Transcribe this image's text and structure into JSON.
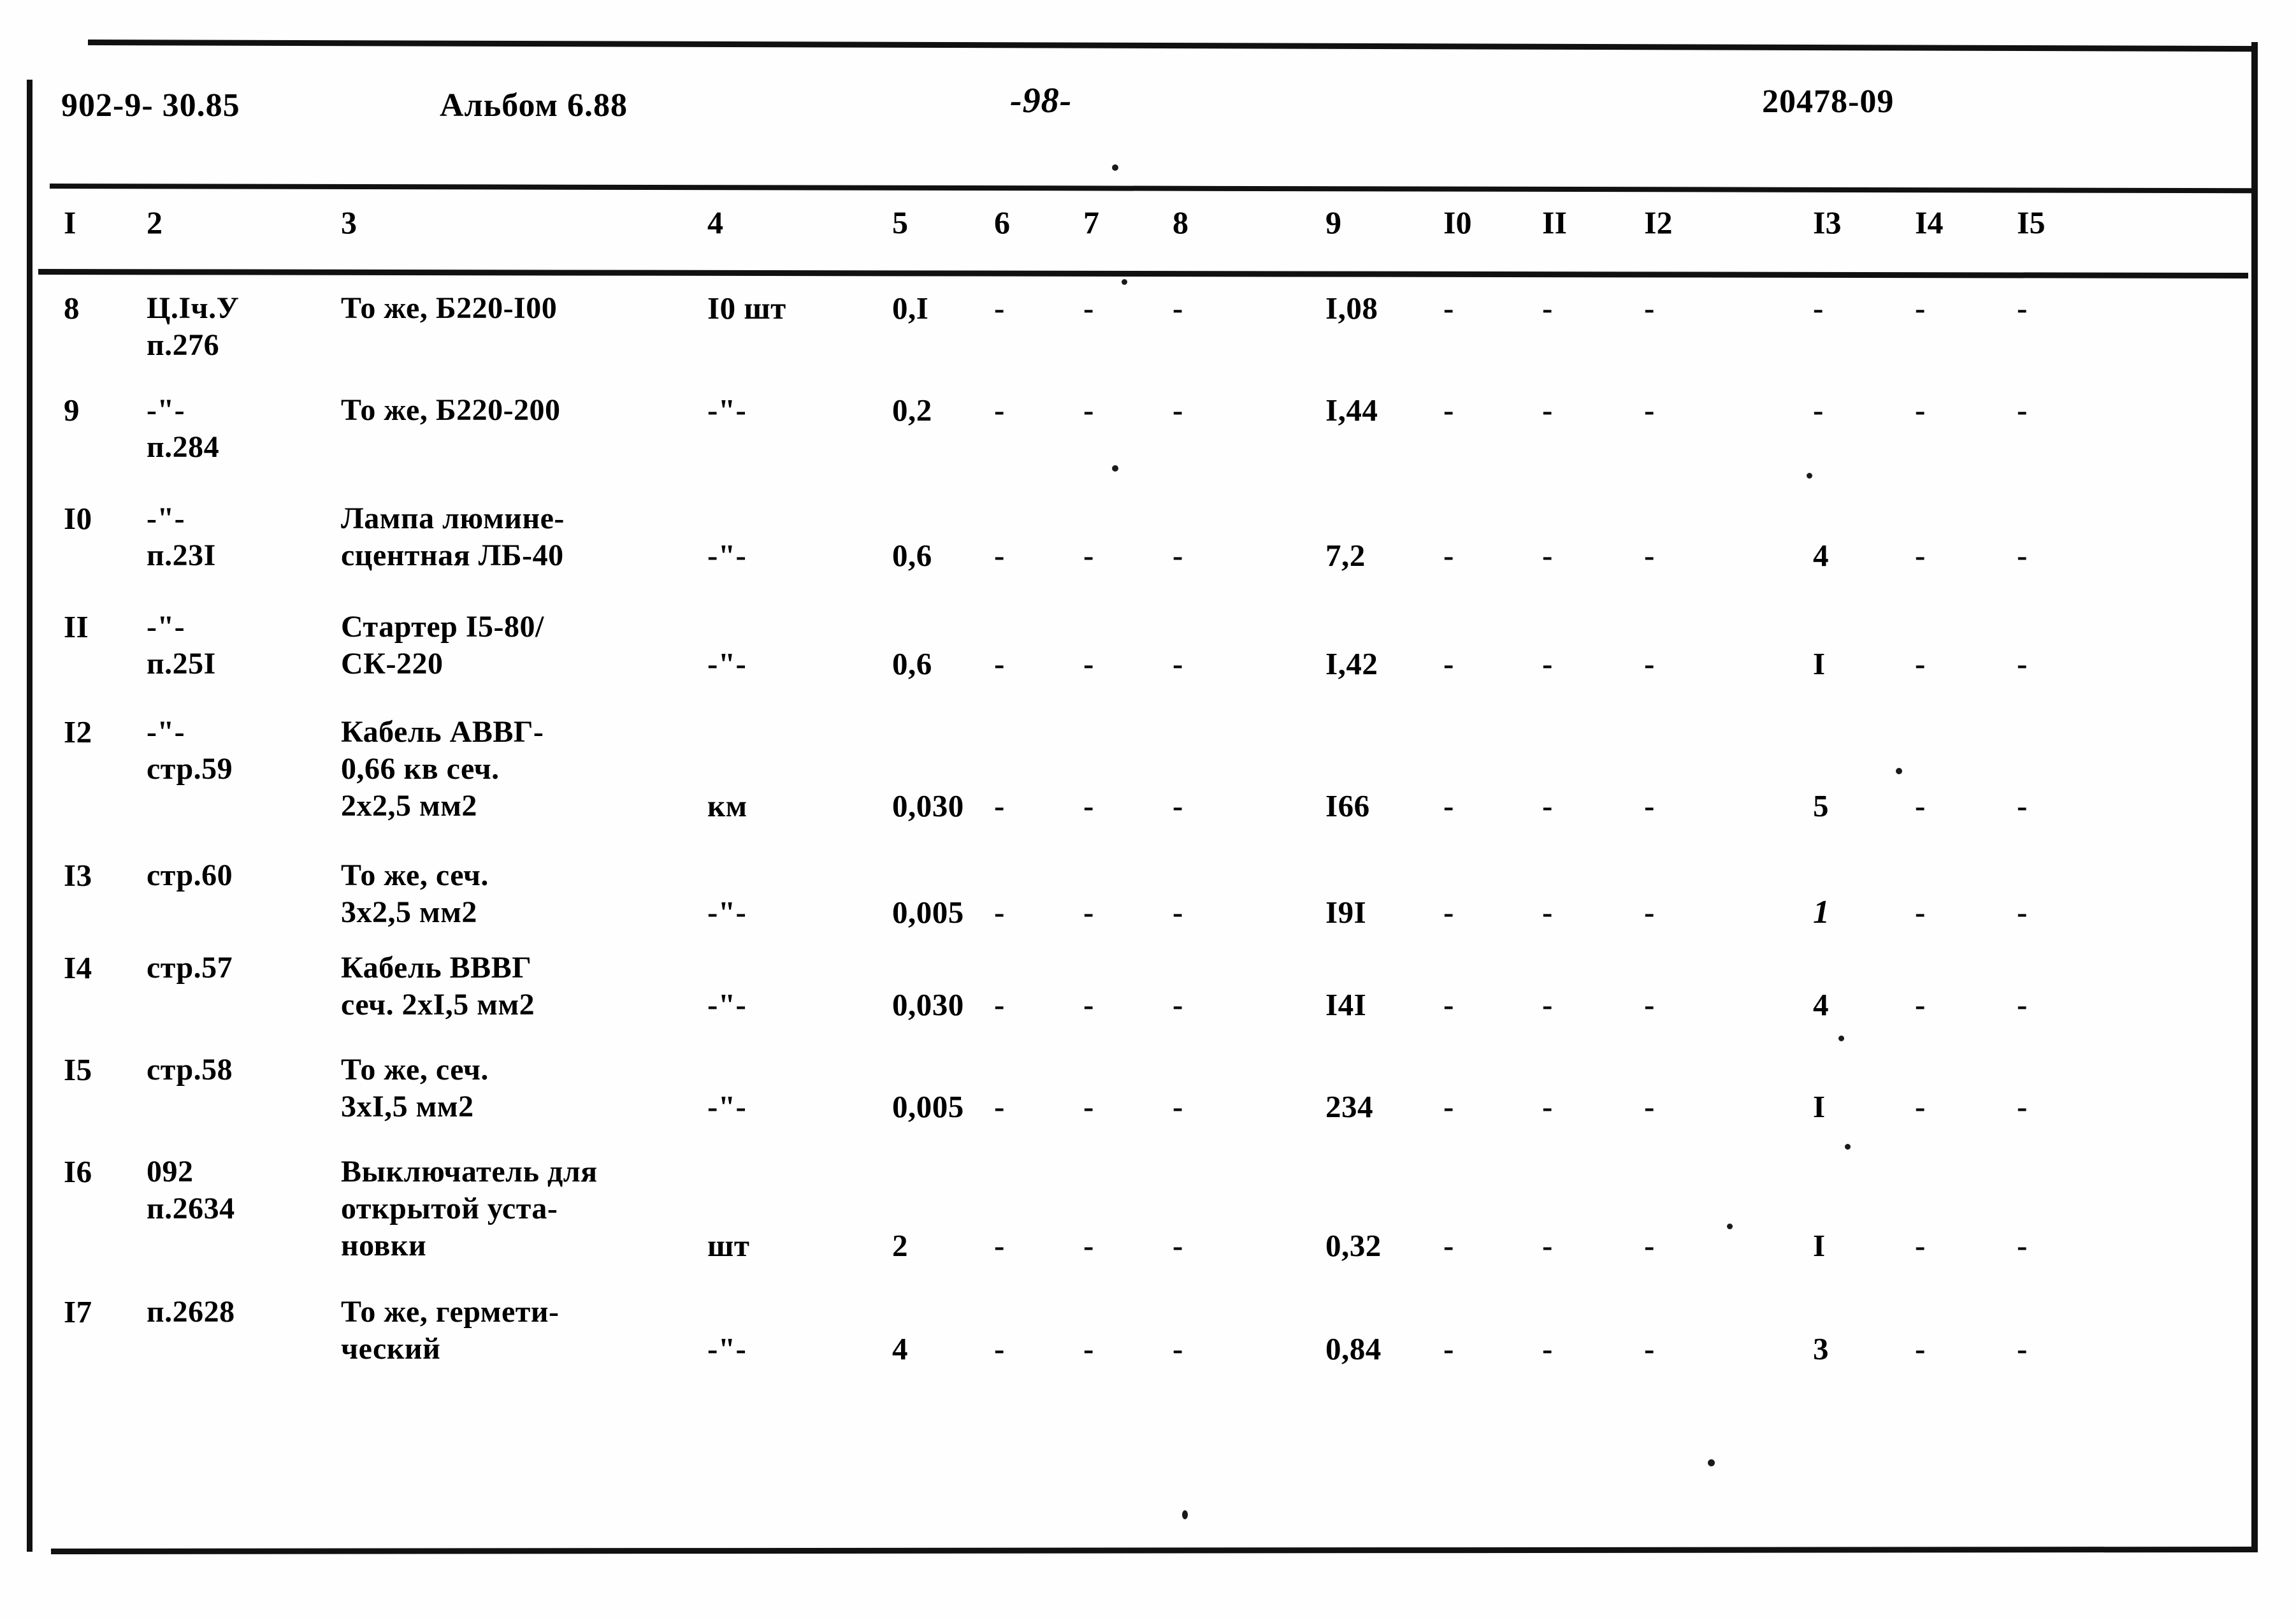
{
  "header": {
    "doc_code": "902-9- 30.85",
    "album": "Альбом 6.88",
    "page_number": "-98-",
    "sheet_code": "20478-09"
  },
  "table": {
    "column_numbers": [
      "I",
      "2",
      "3",
      "4",
      "5",
      "6",
      "7",
      "8",
      "9",
      "I0",
      "II",
      "I2",
      "I3",
      "I4",
      "I5"
    ],
    "rows": [
      {
        "c1": "8",
        "c2_line1": "Ц.Iч.У",
        "c2_line2": "п.276",
        "c3_line1": "То же, Б220-I00",
        "c3_line2": "",
        "c3_line3": "",
        "c4": "I0 шт",
        "c5": "0,I",
        "c6": "-",
        "c7": "-",
        "c8": "-",
        "c9": "I,08",
        "c10": "-",
        "c11": "-",
        "c12": "-",
        "c13": "-",
        "c14": "-",
        "c15": "-"
      },
      {
        "c1": "9",
        "c2_line1": "-\"-",
        "c2_line2": "п.284",
        "c3_line1": "То же, Б220-200",
        "c3_line2": "",
        "c3_line3": "",
        "c4": "-\"-",
        "c5": "0,2",
        "c6": "-",
        "c7": "-",
        "c8": "-",
        "c9": "I,44",
        "c10": "-",
        "c11": "-",
        "c12": "-",
        "c13": "-",
        "c14": "-",
        "c15": "-"
      },
      {
        "c1": "I0",
        "c2_line1": "-\"-",
        "c2_line2": "п.23I",
        "c3_line1": "Лампа люмине-",
        "c3_line2": "сцентная ЛБ-40",
        "c3_line3": "",
        "c4": "-\"-",
        "c5": "0,6",
        "c6": "-",
        "c7": "-",
        "c8": "-",
        "c9": "7,2",
        "c10": "-",
        "c11": "-",
        "c12": "-",
        "c13": "4",
        "c14": "-",
        "c15": "-"
      },
      {
        "c1": "II",
        "c2_line1": "-\"-",
        "c2_line2": "п.25I",
        "c3_line1": "Стартер I5-80/",
        "c3_line2": "СК-220",
        "c3_line3": "",
        "c4": "-\"-",
        "c5": "0,6",
        "c6": "-",
        "c7": "-",
        "c8": "-",
        "c9": "I,42",
        "c10": "-",
        "c11": "-",
        "c12": "-",
        "c13": "I",
        "c14": "-",
        "c15": "-"
      },
      {
        "c1": "I2",
        "c2_line1": "-\"-",
        "c2_line2": "стр.59",
        "c3_line1": "Кабель АВВГ-",
        "c3_line2": "0,66 кв сеч.",
        "c3_line3": "2х2,5 мм2",
        "c4": "км",
        "c5": "0,030",
        "c6": "-",
        "c7": "-",
        "c8": "-",
        "c9": "I66",
        "c10": "-",
        "c11": "-",
        "c12": "-",
        "c13": "5",
        "c14": "-",
        "c15": "-"
      },
      {
        "c1": "I3",
        "c2_line1": "стр.60",
        "c2_line2": "",
        "c3_line1": "То же, сеч.",
        "c3_line2": "3х2,5 мм2",
        "c3_line3": "",
        "c4": "-\"-",
        "c5": "0,005",
        "c6": "-",
        "c7": "-",
        "c8": "-",
        "c9": "I9I",
        "c10": "-",
        "c11": "-",
        "c12": "-",
        "c13": "1",
        "c13_handwritten": true,
        "c14": "-",
        "c15": "-"
      },
      {
        "c1": "I4",
        "c2_line1": "стр.57",
        "c2_line2": "",
        "c3_line1": "Кабель ВВВГ",
        "c3_line2": "сеч. 2хI,5 мм2",
        "c3_line3": "",
        "c4": "-\"-",
        "c5": "0,030",
        "c6": "-",
        "c7": "-",
        "c8": "-",
        "c9": "I4I",
        "c10": "-",
        "c11": "-",
        "c12": "-",
        "c13": "4",
        "c14": "-",
        "c15": "-"
      },
      {
        "c1": "I5",
        "c2_line1": "стр.58",
        "c2_line2": "",
        "c3_line1": "То же, сеч.",
        "c3_line2": "3хI,5 мм2",
        "c3_line3": "",
        "c4": "-\"-",
        "c5": "0,005",
        "c6": "-",
        "c7": "-",
        "c8": "-",
        "c9": "234",
        "c10": "-",
        "c11": "-",
        "c12": "-",
        "c13": "I",
        "c14": "-",
        "c15": "-"
      },
      {
        "c1": "I6",
        "c2_line1": "092",
        "c2_line2": "п.2634",
        "c3_line1": "Выключатель для",
        "c3_line2": "открытой уста-",
        "c3_line3": "новки",
        "c4": "шт",
        "c5": "2",
        "c6": "-",
        "c7": "-",
        "c8": "-",
        "c9": "0,32",
        "c10": "-",
        "c11": "-",
        "c12": "-",
        "c13": "I",
        "c14": "-",
        "c15": "-"
      },
      {
        "c1": "I7",
        "c2_line1": "п.2628",
        "c2_line2": "",
        "c3_line1": "То же, гермети-",
        "c3_line2": "ческий",
        "c3_line3": "",
        "c4": "-\"-",
        "c5": "4",
        "c6": "-",
        "c7": "-",
        "c8": "-",
        "c9": "0,84",
        "c10": "-",
        "c11": "-",
        "c12": "-",
        "c13": "3",
        "c14": "-",
        "c15": "-"
      }
    ]
  }
}
